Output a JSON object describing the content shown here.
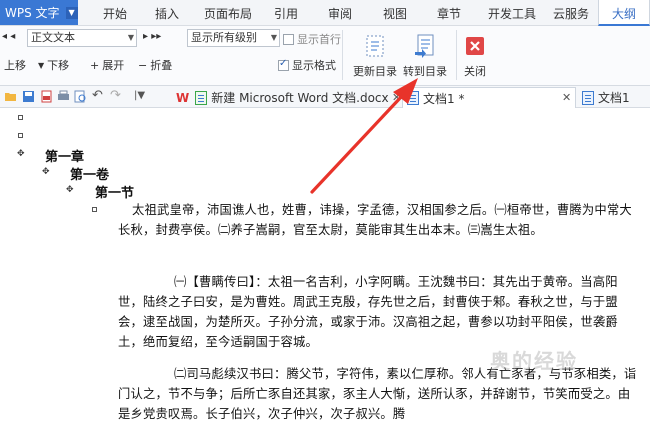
{
  "app": {
    "name": "WPS 文字"
  },
  "tabs": [
    "开始",
    "插入",
    "页面布局",
    "引用",
    "审阅",
    "视图",
    "章节",
    "开发工具",
    "云服务",
    "大纲"
  ],
  "active_tab": "大纲",
  "ribbon": {
    "style_combo": "正文文本",
    "level_combo": "显示所有级别",
    "show_first_line": "显示首行",
    "show_format": "显示格式",
    "move_up": "上移",
    "move_down": "下移",
    "expand": "展开",
    "collapse": "折叠",
    "update_toc": "更新目录",
    "goto_toc": "转到目录",
    "close": "关闭"
  },
  "doc_tabs": [
    {
      "label": "新建 Microsoft Word 文档.docx",
      "active": false
    },
    {
      "label": "文档1 *",
      "active": true
    },
    {
      "label": "文档1",
      "active": false
    }
  ],
  "outline": {
    "h1": "第一章",
    "h2": "第一卷",
    "h3": "第一节",
    "p1": "太祖武皇帝，沛国谯人也，姓曹，讳操，字孟德，汉相国参之后。㈠桓帝世，曹腾为中常大长秋，封费亭侯。㈡养子嵩嗣，官至太尉，莫能审其生出本末。㈢嵩生太祖。",
    "p2": "㈠【曹瞒传曰】：太祖一名吉利，小字阿瞒。王沈魏书曰：其先出于黄帝。当高阳世，陆终之子曰安，是为曹姓。周武王克殷，存先世之后，封曹侠于邾。春秋之世，与于盟会，逮至战国，为楚所灭。子孙分流，或家于沛。汉高祖之起，曹参以功封平阳侯，世袭爵土，绝而复绍，至今适嗣国于容城。",
    "p3": "㈡司马彪续汉书曰：腾父节，字符伟，素以仁厚称。邻人有亡豕者，与节豕相类，诣门认之，节不与争；后所亡豕自还其家，豕主人大惭，送所认豕，并辞谢节，节笑而受之。由是乡党贵叹焉。长子伯兴，次子仲兴，次子叔兴。腾"
  },
  "watermark": "奥的经验",
  "colors": {
    "accent": "#3a78d4",
    "arrow": "#e8332a"
  }
}
